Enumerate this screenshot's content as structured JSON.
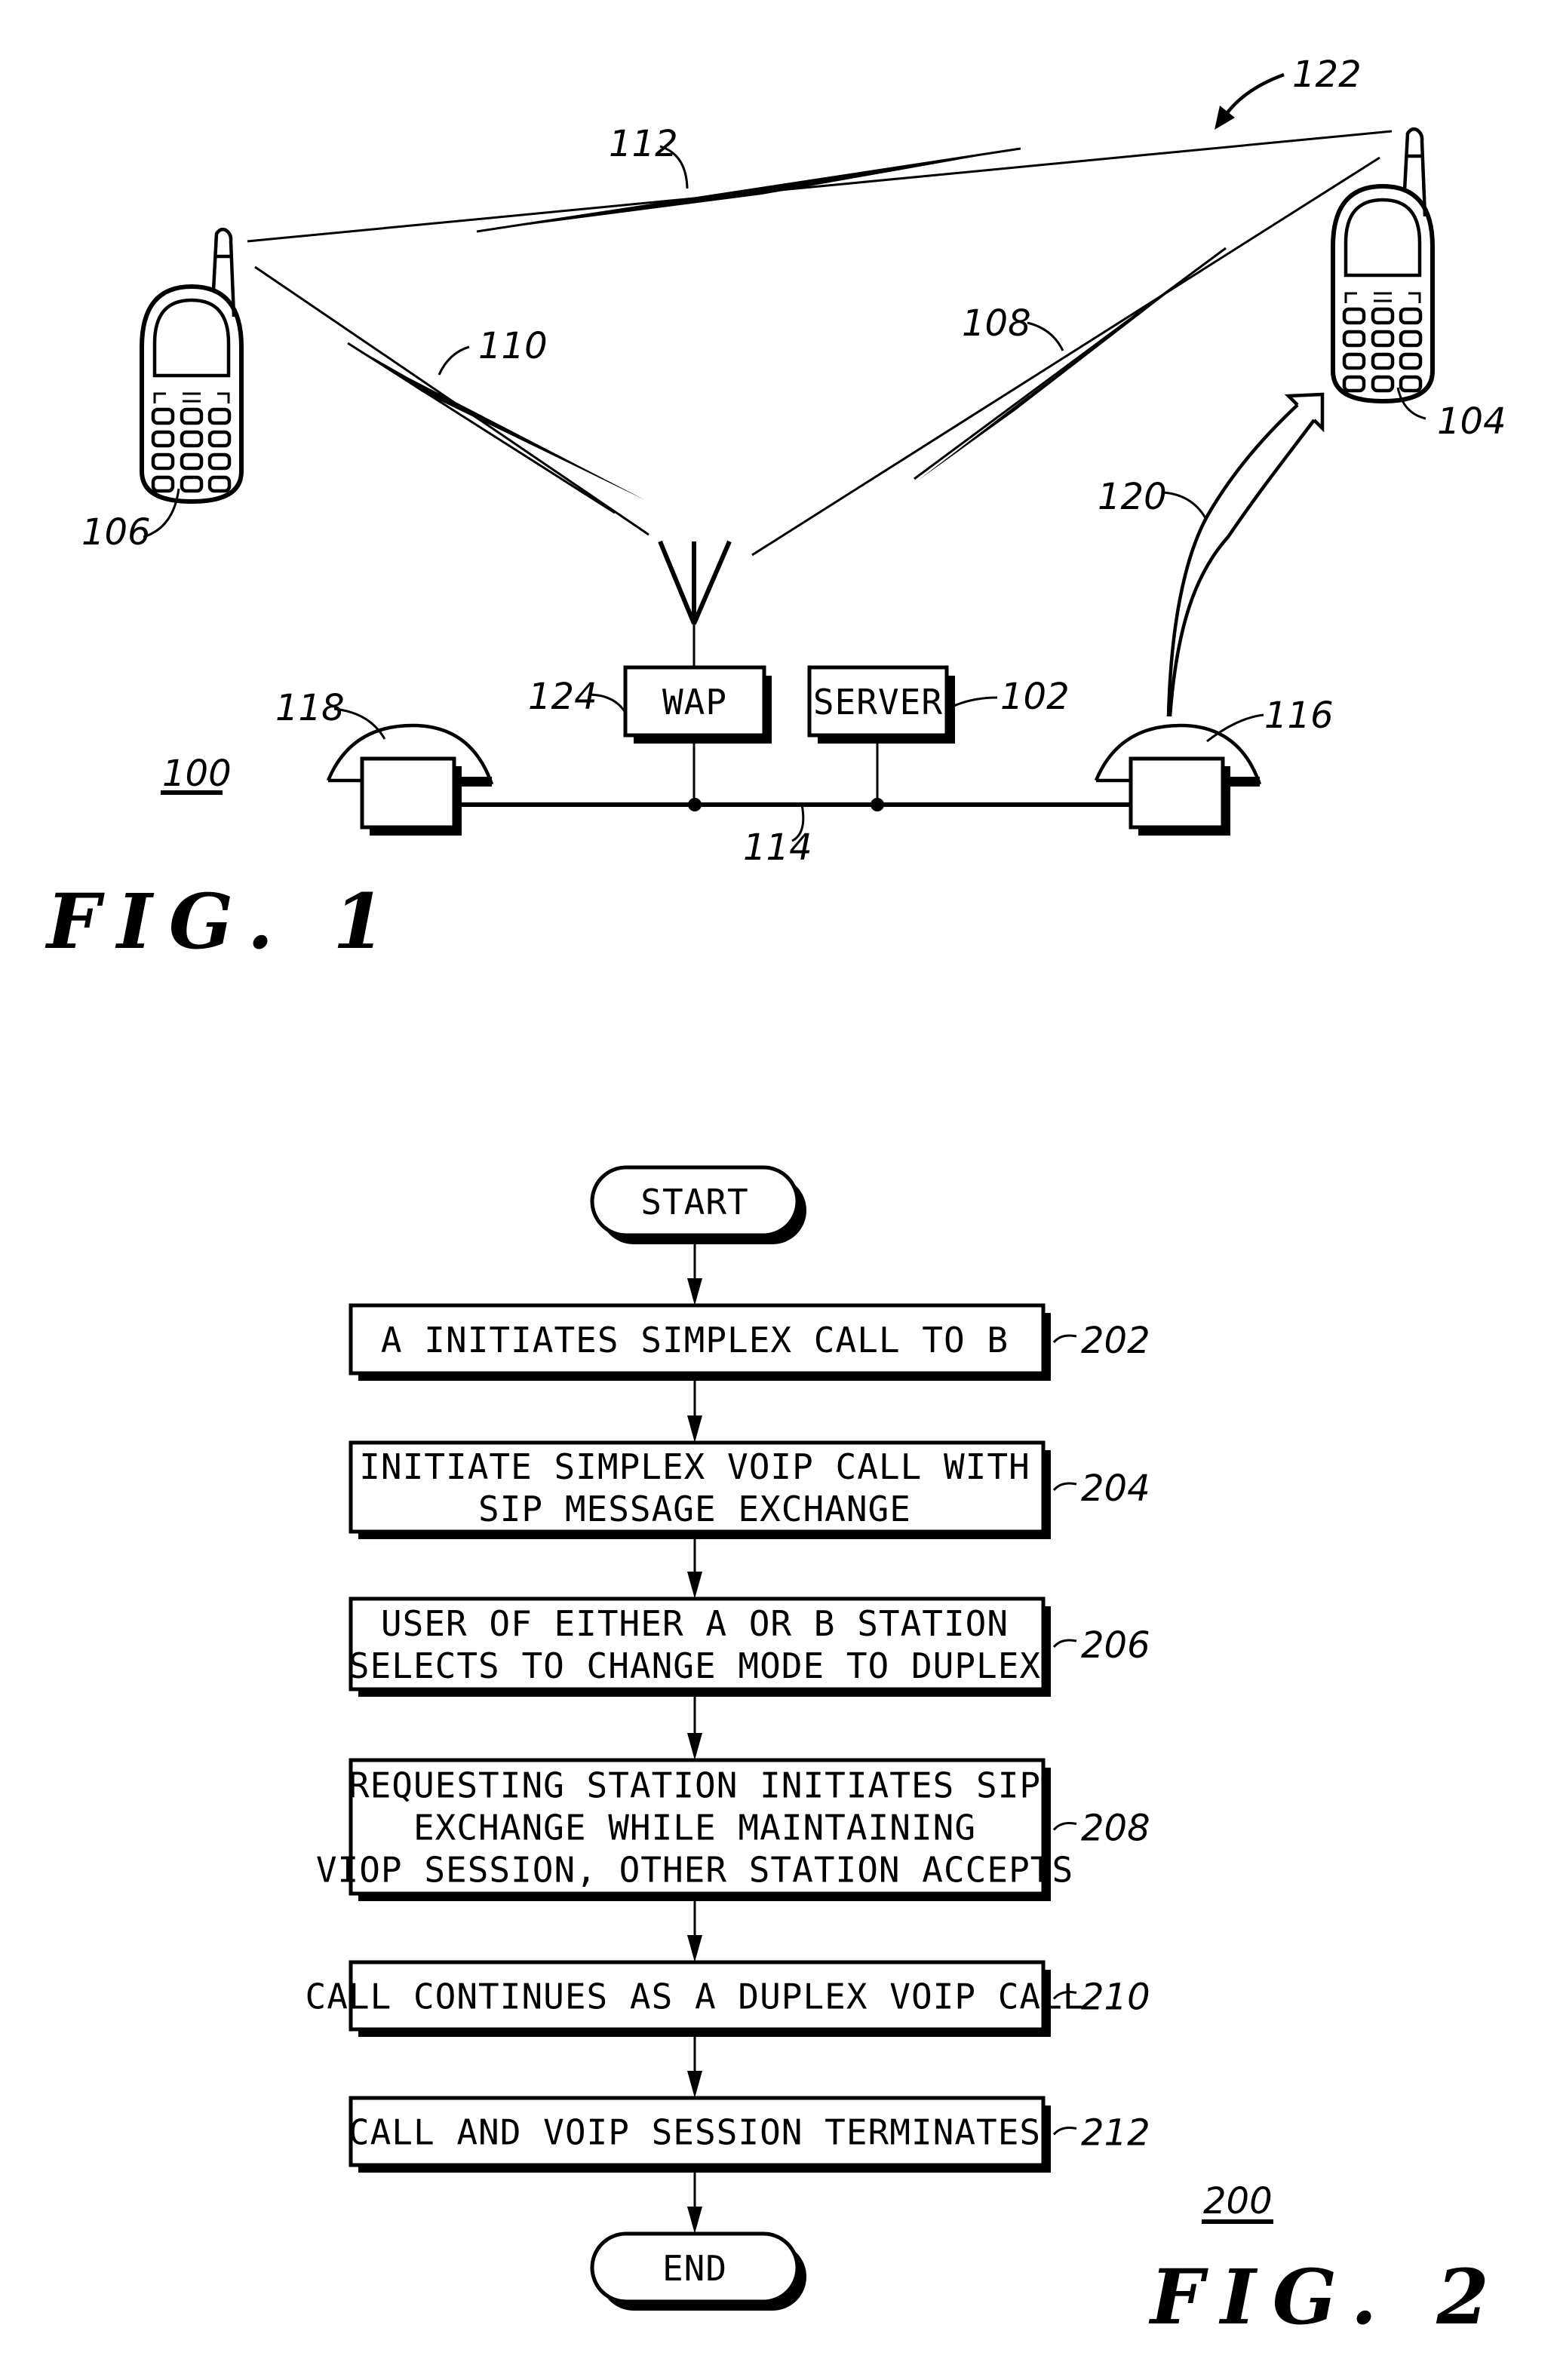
{
  "page": {
    "colors": {
      "ink": "#000000",
      "paper": "#ffffff"
    }
  },
  "fig1": {
    "title": "FIG. 1",
    "system_ref": "100",
    "blocks": {
      "wap": {
        "label": "WAP",
        "ref": "124"
      },
      "server": {
        "label": "SERVER",
        "ref": "102"
      }
    },
    "devices": {
      "mobile_b": {
        "ref": "104",
        "icon": "cell-phone-icon"
      },
      "mobile_a": {
        "ref": "106",
        "icon": "cell-phone-icon"
      },
      "desk_phone_right": {
        "ref": "116",
        "icon": "desk-telephone-icon"
      },
      "desk_phone_left": {
        "ref": "118",
        "icon": "desk-telephone-icon"
      },
      "antenna": {
        "icon": "antenna-icon"
      }
    },
    "links": {
      "wap_to_104": "108",
      "wap_to_106": "110",
      "direct_106_104": "112",
      "lan_bus": "114",
      "forward_arrow": "120",
      "group_arrow": "122"
    }
  },
  "fig2": {
    "title": "FIG. 2",
    "method_ref": "200",
    "start_label": "START",
    "end_label": "END",
    "steps": [
      {
        "ref": "202",
        "lines": [
          "A INITIATES SIMPLEX CALL TO B"
        ]
      },
      {
        "ref": "204",
        "lines": [
          "INITIATE SIMPLEX VOIP CALL WITH",
          "SIP MESSAGE EXCHANGE"
        ]
      },
      {
        "ref": "206",
        "lines": [
          "USER OF EITHER A OR B STATION",
          "SELECTS TO CHANGE MODE TO DUPLEX"
        ]
      },
      {
        "ref": "208",
        "lines": [
          "REQUESTING STATION INITIATES SIP",
          "EXCHANGE WHILE MAINTAINING",
          "VIOP SESSION, OTHER STATION ACCEPTS"
        ]
      },
      {
        "ref": "210",
        "lines": [
          "CALL CONTINUES AS A DUPLEX VOIP CALL"
        ]
      },
      {
        "ref": "212",
        "lines": [
          "CALL AND VOIP SESSION TERMINATES"
        ]
      }
    ]
  }
}
